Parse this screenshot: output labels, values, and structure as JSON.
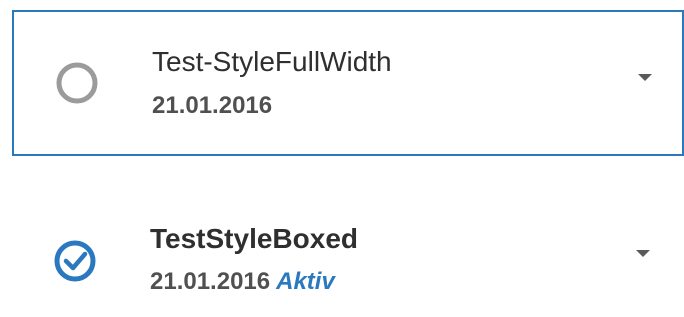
{
  "items": [
    {
      "title": "Test-StyleFullWidth",
      "date": "21.01.2016",
      "status": "",
      "active": false,
      "icon": "empty-circle-icon"
    },
    {
      "title": "TestStyleBoxed",
      "date": "21.01.2016",
      "status": "Aktiv",
      "active": true,
      "icon": "check-circle-icon"
    }
  ],
  "colors": {
    "accent": "#2a78bf",
    "inactive_icon": "#9b9b9b",
    "text": "#2f2f2f",
    "subtext": "#505050"
  }
}
